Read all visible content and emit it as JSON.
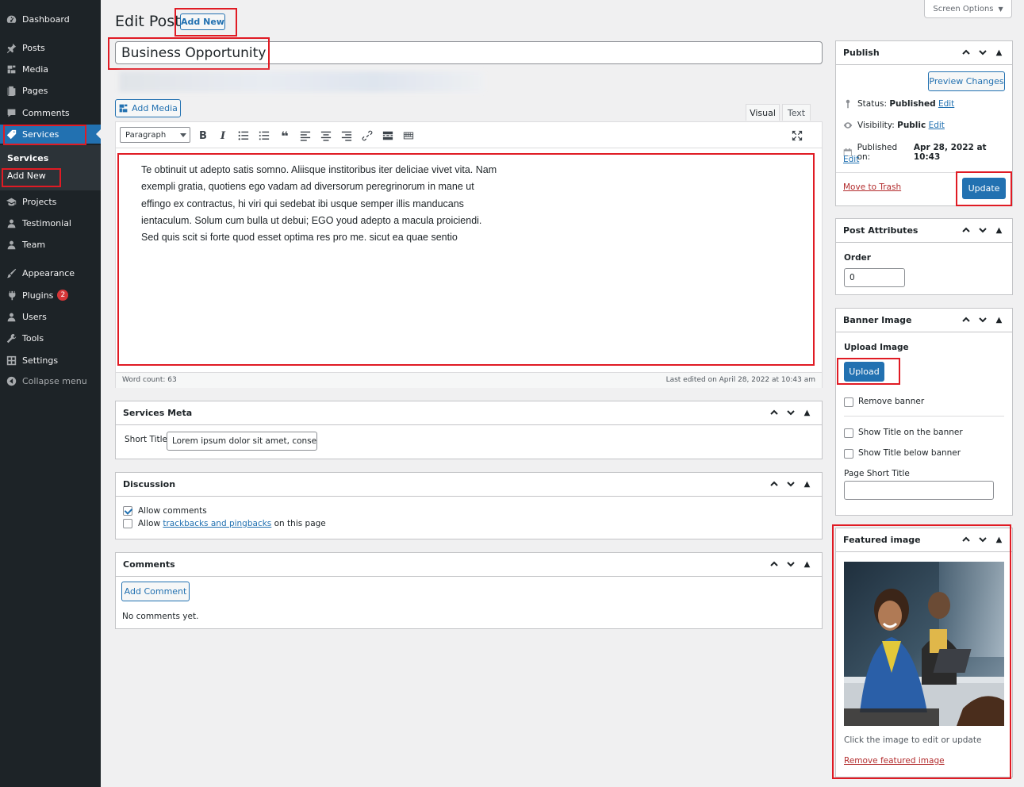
{
  "sidebar": {
    "items": [
      {
        "label": "Dashboard",
        "icon": "dashboard-icon"
      },
      {
        "label": "Posts",
        "icon": "pin-icon"
      },
      {
        "label": "Media",
        "icon": "media-icon"
      },
      {
        "label": "Pages",
        "icon": "pages-icon"
      },
      {
        "label": "Comments",
        "icon": "comments-icon"
      },
      {
        "label": "Services",
        "icon": "tag-icon"
      },
      {
        "label": "Projects",
        "icon": "graduation-cap-icon"
      },
      {
        "label": "Testimonial",
        "icon": "users-icon"
      },
      {
        "label": "Team",
        "icon": "users-icon"
      },
      {
        "label": "Appearance",
        "icon": "brush-icon"
      },
      {
        "label": "Plugins",
        "icon": "plugin-icon",
        "badge": "2"
      },
      {
        "label": "Users",
        "icon": "user-icon"
      },
      {
        "label": "Tools",
        "icon": "wrench-icon"
      },
      {
        "label": "Settings",
        "icon": "settings-icon"
      },
      {
        "label": "Collapse menu",
        "icon": "collapse-icon"
      }
    ],
    "submenu": {
      "heading": "Services",
      "add_new": "Add New"
    }
  },
  "header": {
    "title": "Edit Post",
    "add_new": "Add New",
    "screen_options": "Screen Options"
  },
  "post": {
    "title": "Business Opportunity"
  },
  "editor": {
    "add_media": "Add Media",
    "tab_visual": "Visual",
    "tab_text": "Text",
    "format": "Paragraph",
    "content": [
      "Te obtinuit ut adepto satis somno. Aliisque institoribus iter deliciae vivet vita. Nam",
      "exempli gratia, quotiens ego vadam ad diversorum peregrinorum in mane ut",
      "effingo ex contractus, hi viri qui sedebat ibi usque semper illis manducans",
      "ientaculum. Solum cum bulla ut debui; EGO youd adepto a macula proiciendi.",
      "Sed quis scit si forte quod esset optima res pro me. sicut ea quae sentio"
    ],
    "word_count": "Word count: 63",
    "last_edited": "Last edited on April 28, 2022 at 10:43 am"
  },
  "services_meta": {
    "heading": "Services Meta",
    "short_title_label": "Short Title",
    "short_title_value": "Lorem ipsum dolor sit amet, conse"
  },
  "discussion": {
    "heading": "Discussion",
    "allow_comments": "Allow comments",
    "allow_prefix": "Allow",
    "trackbacks_link": "trackbacks and pingbacks",
    "allow_suffix": "on this page"
  },
  "comments": {
    "heading": "Comments",
    "add_comment": "Add Comment",
    "none": "No comments yet."
  },
  "publish": {
    "heading": "Publish",
    "preview": "Preview Changes",
    "status_label": "Status:",
    "status_value": "Published",
    "visibility_label": "Visibility:",
    "visibility_value": "Public",
    "published_label": "Published on:",
    "published_value": "Apr 28, 2022 at 10:43",
    "edit": "Edit",
    "trash": "Move to Trash",
    "update": "Update"
  },
  "post_attributes": {
    "heading": "Post Attributes",
    "order_label": "Order",
    "order_value": "0"
  },
  "banner": {
    "heading": "Banner Image",
    "upload_label": "Upload Image",
    "upload_button": "Upload",
    "remove_banner": "Remove banner",
    "show_title_on": "Show Title on the banner",
    "show_title_below": "Show Title below banner",
    "page_short_title": "Page Short Title"
  },
  "featured": {
    "heading": "Featured image",
    "hint": "Click the image to edit or update",
    "remove": "Remove featured image"
  },
  "colors": {
    "sidebar_bg": "#1d2327",
    "accent": "#2271b1",
    "highlight_box": "#e01b24"
  }
}
